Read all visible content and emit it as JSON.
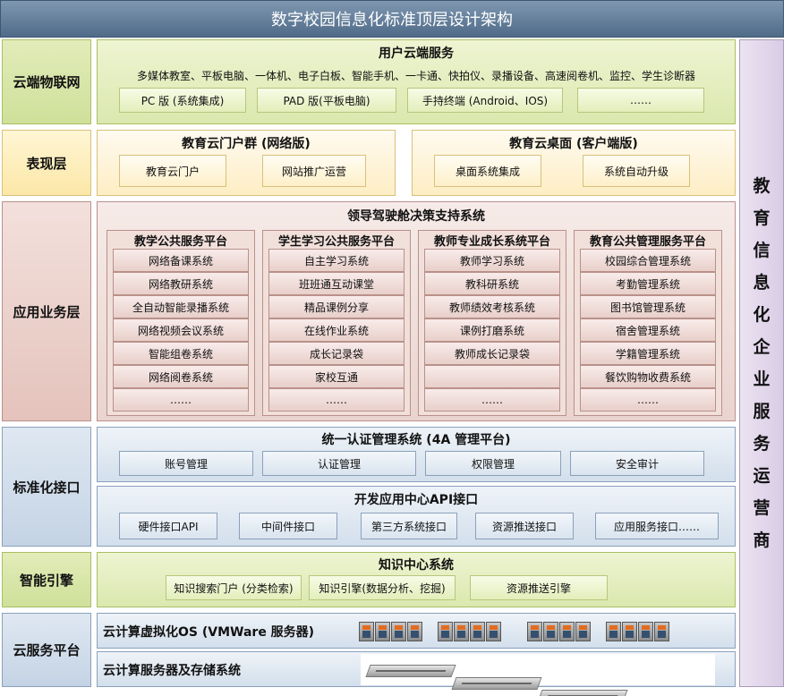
{
  "title": "数字校园信息化标准顶层设计架构",
  "right_bar": [
    "教",
    "育",
    "信",
    "息",
    "化",
    "企",
    "业",
    "服",
    "务",
    "运",
    "营",
    "商"
  ],
  "layers": {
    "cloud_iot": {
      "label": "云端物联网",
      "title": "用户云端服务",
      "devices": "多媒体教室、平板电脑、一体机、电子白板、智能手机、一卡通、快拍仪、录播设备、高速阅卷机、监控、学生诊断器",
      "boxes": [
        "PC 版 (系统集成)",
        "PAD 版(平板电脑)",
        "手持终端 (Android、IOS)",
        "……"
      ]
    },
    "presentation": {
      "label": "表现层",
      "left_title": "教育云门户群 (网络版)",
      "left_boxes": [
        "教育云门户",
        "网站推广运营"
      ],
      "right_title": "教育云桌面 (客户端版)",
      "right_boxes": [
        "桌面系统集成",
        "系统自动升级"
      ]
    },
    "application": {
      "label": "应用业务层",
      "title": "领导驾驶舱决策支持系统",
      "columns": [
        {
          "title": "教学公共服务平台",
          "items": [
            "网络备课系统",
            "网络教研系统",
            "全自动智能录播系统",
            "网络视频会议系统",
            "智能组卷系统",
            "网络阅卷系统",
            "……"
          ]
        },
        {
          "title": "学生学习公共服务平台",
          "items": [
            "自主学习系统",
            "班班通互动课堂",
            "精品课例分享",
            "在线作业系统",
            "成长记录袋",
            "家校互通",
            "……"
          ]
        },
        {
          "title": "教师专业成长系统平台",
          "items": [
            "教师学习系统",
            "教科研系统",
            "教师绩效考核系统",
            "课例打磨系统",
            "教师成长记录袋",
            "",
            "……"
          ]
        },
        {
          "title": "教育公共管理服务平台",
          "items": [
            "校园综合管理系统",
            "考勤管理系统",
            "图书馆管理系统",
            "宿舍管理系统",
            "学籍管理系统",
            "餐饮购物收费系统",
            "……"
          ]
        }
      ]
    },
    "interface": {
      "label": "标准化接口",
      "auth_title": "统一认证管理系统 (4A 管理平台)",
      "auth_boxes": [
        "账号管理",
        "认证管理",
        "权限管理",
        "安全审计"
      ],
      "api_title": "开发应用中心API接口",
      "api_boxes": [
        "硬件接口API",
        "中间件接口",
        "第三方系统接口",
        "资源推送接口",
        "应用服务接口……"
      ]
    },
    "engine": {
      "label": "智能引擎",
      "title": "知识中心系统",
      "boxes": [
        "知识搜索门户 (分类检索)",
        "知识引擎(数据分析、挖掘)",
        "资源推送引擎"
      ]
    },
    "cloud_platform": {
      "label": "云服务平台",
      "row1": "云计算虚拟化OS (VMWare 服务器)",
      "row2": "云计算服务器及存储系统"
    }
  }
}
